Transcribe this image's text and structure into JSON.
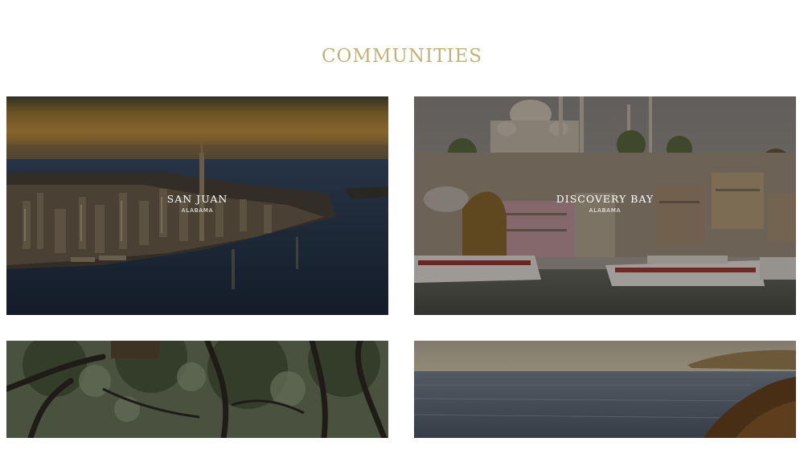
{
  "section": {
    "title": "COMMUNITIES"
  },
  "communities": [
    {
      "name": "SAN JUAN",
      "state": "ALABAMA",
      "image": "city-skyline-sunset"
    },
    {
      "name": "DISCOVERY BAY",
      "state": "ALABAMA",
      "image": "mosque-harbor-ferries"
    },
    {
      "name": "",
      "state": "",
      "image": "oak-trees-spanish-moss"
    },
    {
      "name": "",
      "state": "",
      "image": "coastal-cliff-sea"
    }
  ]
}
